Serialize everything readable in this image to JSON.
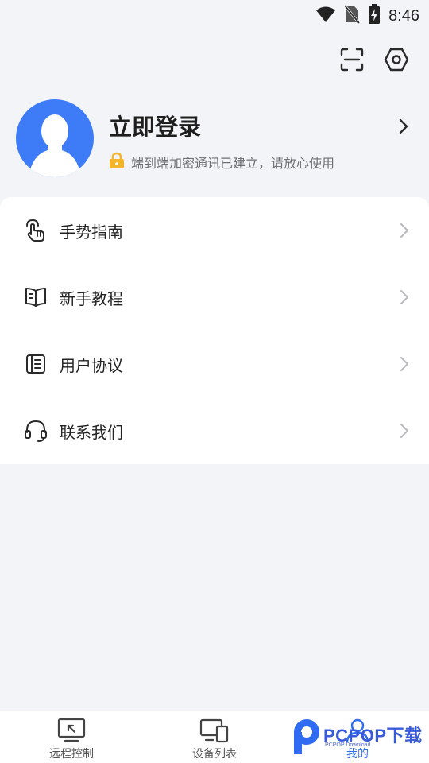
{
  "status_bar": {
    "time": "8:46",
    "icons": [
      "wifi-icon",
      "no-sim-icon",
      "battery-charging-icon"
    ]
  },
  "top_actions": [
    "scan-icon",
    "settings-icon"
  ],
  "profile": {
    "title": "立即登录",
    "secure_text": "端到端加密通讯已建立，请放心使用",
    "avatar_color": "#3d7bf7",
    "lock_color": "#f5b52a"
  },
  "menu": {
    "items": [
      {
        "label": "手势指南",
        "icon": "hand-gesture-icon"
      },
      {
        "label": "新手教程",
        "icon": "book-icon"
      },
      {
        "label": "用户协议",
        "icon": "document-icon"
      },
      {
        "label": "联系我们",
        "icon": "headset-icon"
      }
    ]
  },
  "bottom_nav": {
    "items": [
      {
        "label": "远程控制",
        "icon": "remote-monitor-icon",
        "active": false
      },
      {
        "label": "设备列表",
        "icon": "devices-icon",
        "active": false
      },
      {
        "label": "我的",
        "icon": "profile-icon",
        "active": true
      }
    ],
    "active_color": "#2f6cf2"
  },
  "watermark": {
    "brand": "PCPOP下载",
    "sub": "PCPOP Download"
  }
}
